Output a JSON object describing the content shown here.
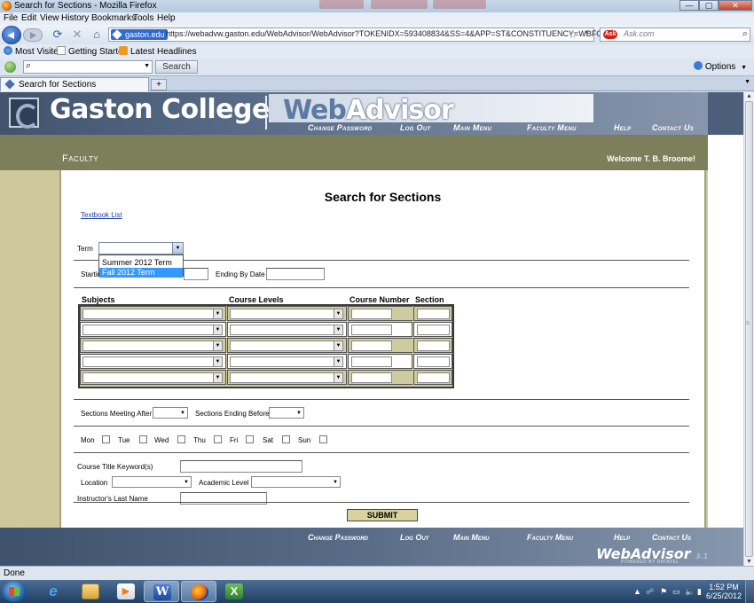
{
  "window": {
    "title": "Search for Sections - Mozilla Firefox",
    "minimize_glyph": "—",
    "maximize_glyph": "▢",
    "close_glyph": "✕"
  },
  "menu": [
    "File",
    "Edit",
    "View",
    "History",
    "Bookmarks",
    "Tools",
    "Help"
  ],
  "address": {
    "site_badge": "gaston.edu",
    "url": "https://webadvw.gaston.edu/WebAdvisor/WebAdvisor?TOKENIDX=593408834&SS=4&APP=ST&CONSTITUENCY=WBFC"
  },
  "search_box": {
    "logo": "Ask",
    "placeholder": "Ask.com"
  },
  "bookmarks": [
    "Most Visited",
    "Getting Started",
    "Latest Headlines"
  ],
  "toolbar": {
    "search_button": "Search",
    "options_label": "Options"
  },
  "tab": {
    "label": "Search for Sections",
    "new_tab_glyph": "+"
  },
  "header": {
    "college_name": "Gaston College",
    "logo_web": "Web",
    "logo_advisor": "Advisor",
    "nav": [
      "Change Password",
      "Log Out",
      "Main Menu",
      "Faculty Menu",
      "Help",
      "Contact Us"
    ]
  },
  "banner": {
    "section": "Faculty",
    "welcome": "Welcome T. B. Broome!"
  },
  "form": {
    "title": "Search for Sections",
    "textbook_link": "Textbook List",
    "term_label": "Term",
    "term_options": [
      "Summer 2012 Term",
      "Fall 2012 Term"
    ],
    "term_highlighted": "Fall 2012 Term",
    "starting_label": "Startin",
    "ending_label": "Ending By Date",
    "col_subjects": "Subjects",
    "col_levels": "Course Levels",
    "col_number": "Course Number",
    "col_section": "Section",
    "meeting_after": "Sections Meeting After",
    "ending_before": "Sections Ending Before",
    "days": [
      "Mon",
      "Tue",
      "Wed",
      "Thu",
      "Fri",
      "Sat",
      "Sun"
    ],
    "keyword_label": "Course Title Keyword(s)",
    "location_label": "Location",
    "academic_level_label": "Academic Level",
    "instructor_label": "Instructor's Last Name",
    "submit": "SUBMIT"
  },
  "footer": {
    "nav": [
      "Change Password",
      "Log Out",
      "Main Menu",
      "Faculty Menu",
      "Help",
      "Contact Us"
    ],
    "logo": "WebAdvisor",
    "version": "3.1",
    "powered": "POWERED BY DATATEL"
  },
  "status": "Done",
  "clock": {
    "time": "1:52 PM",
    "date": "6/25/2012"
  }
}
